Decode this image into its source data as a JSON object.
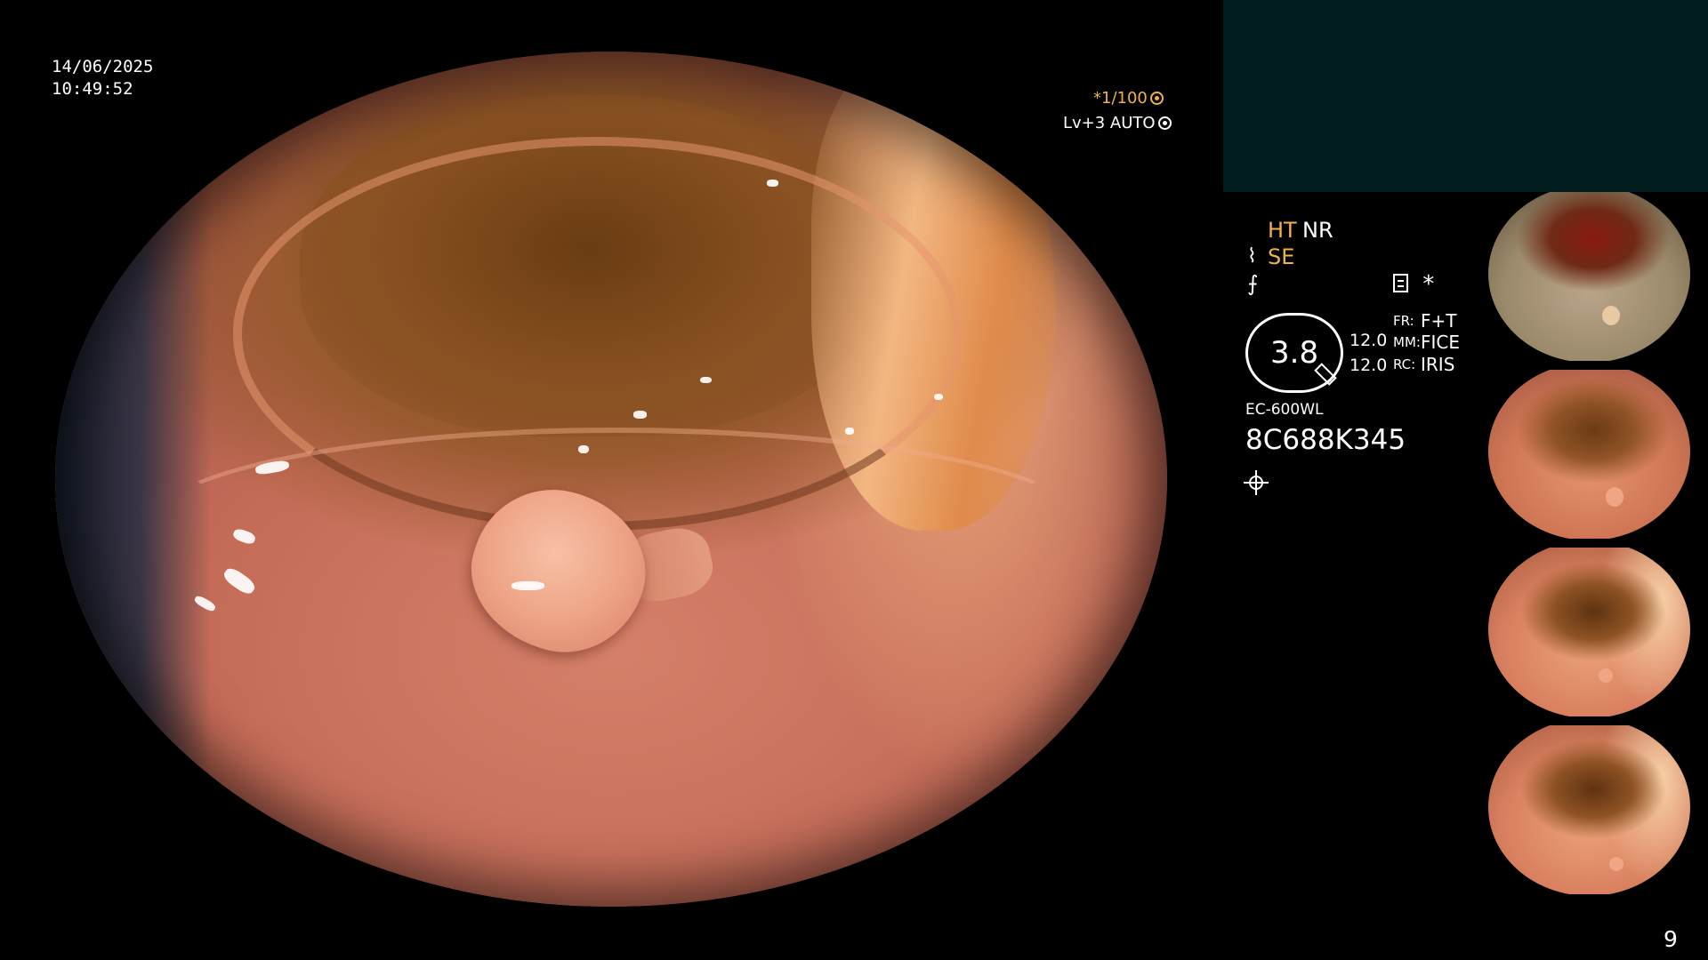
{
  "osd": {
    "date": "14/06/2025",
    "time": "10:49:52",
    "shutter": "*1/100",
    "level": "Lv+3 AUTO"
  },
  "panel": {
    "ht": "HT",
    "nr": "NR",
    "se": "SE",
    "star": "*",
    "dial_value": "3.8",
    "num_top": "12.0",
    "num_bottom": "12.0",
    "fr_label": "FR:",
    "fr_value": "F+T",
    "mm_label": "MM:",
    "mm_value": "FICE",
    "rc_label": "RC:",
    "rc_value": "IRIS",
    "model": "EC-600WL",
    "serial": "8C688K345"
  },
  "page_number": "9",
  "colors": {
    "accent_orange": "#f0b24a",
    "teal_box": "#011c1c",
    "background": "#000000"
  },
  "icons": [
    "shutter-icon",
    "auto-icon",
    "se-mode-icon",
    "enhance-icon",
    "memo-icon",
    "dial-tool-icon",
    "light-icon"
  ]
}
